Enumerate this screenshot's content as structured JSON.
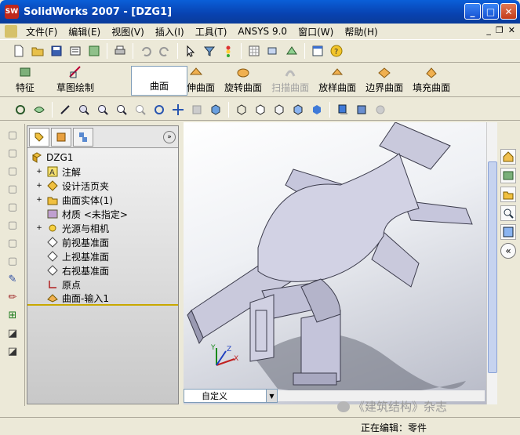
{
  "window": {
    "title": "SolidWorks 2007 - [DZG1]",
    "logo": "SW",
    "minimize": "_",
    "maximize": "□",
    "close": "✕"
  },
  "menu": {
    "items": [
      "文件(F)",
      "编辑(E)",
      "视图(V)",
      "插入(I)",
      "工具(T)",
      "ANSYS 9.0",
      "窗口(W)",
      "帮助(H)"
    ],
    "mdi_minimize": "_",
    "mdi_restore": "❐",
    "mdi_close": "✕"
  },
  "toolbar1": {
    "icons": [
      "new-icon",
      "open-icon",
      "save-icon",
      "print-preview-icon",
      "options-icon",
      "print-icon",
      "undo-icon",
      "redo-icon",
      "select-icon",
      "select-filter-icon",
      "rebuild-icon",
      "grid-icon",
      "view-orient-icon",
      "options-icon-2",
      "window-icon",
      "help-icon"
    ]
  },
  "command_manager": {
    "tabs": [
      {
        "label": "特征"
      },
      {
        "label": "草图绘制"
      },
      {
        "label": "曲面"
      }
    ],
    "commands": [
      {
        "label": "拉伸曲面",
        "enabled": true
      },
      {
        "label": "旋转曲面",
        "enabled": true
      },
      {
        "label": "扫描曲面",
        "enabled": false
      },
      {
        "label": "放样曲面",
        "enabled": true
      },
      {
        "label": "边界曲面",
        "enabled": true
      },
      {
        "label": "填充曲面",
        "enabled": true
      }
    ]
  },
  "feature_tree": {
    "root": "DZG1",
    "nodes": [
      {
        "label": "注解",
        "expandable": true,
        "icon": "annotation-icon"
      },
      {
        "label": "设计活页夹",
        "expandable": true,
        "icon": "design-binder-icon"
      },
      {
        "label": "曲面实体(1)",
        "expandable": true,
        "icon": "surface-body-icon"
      },
      {
        "label": "材质 <未指定>",
        "expandable": false,
        "icon": "material-icon"
      },
      {
        "label": "光源与相机",
        "expandable": true,
        "icon": "lights-cameras-icon"
      },
      {
        "label": "前视基准面",
        "expandable": false,
        "icon": "plane-icon"
      },
      {
        "label": "上视基准面",
        "expandable": false,
        "icon": "plane-icon"
      },
      {
        "label": "右视基准面",
        "expandable": false,
        "icon": "plane-icon"
      },
      {
        "label": "原点",
        "expandable": false,
        "icon": "origin-icon"
      },
      {
        "label": "曲面-输入1",
        "expandable": false,
        "icon": "surface-import-icon"
      }
    ]
  },
  "viewport": {
    "view_dropdown": "自定义",
    "triad": {
      "x": "X",
      "y": "Y",
      "z": "Z"
    }
  },
  "status": {
    "text": "正在编辑：零件"
  },
  "watermark": {
    "text": "《建筑结构》杂志"
  },
  "colors": {
    "title_bar": "#0a4fc8",
    "model_face": "#c8c8dc",
    "model_edge": "#3c3c4c",
    "rollback_bar": "#c8a800"
  }
}
